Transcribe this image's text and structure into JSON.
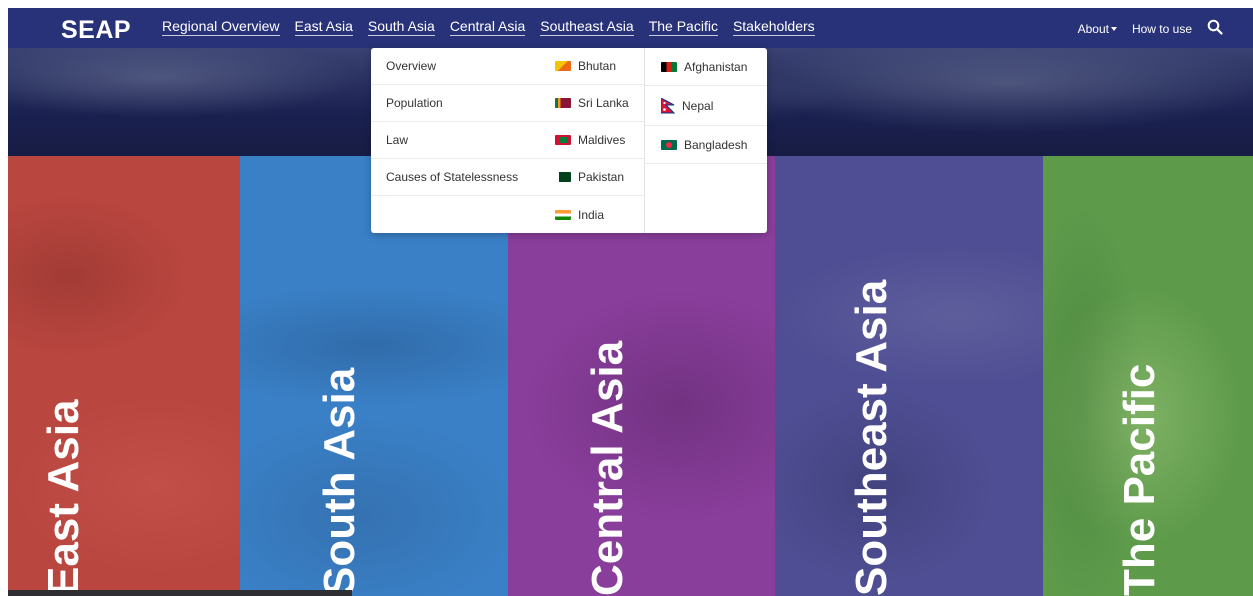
{
  "nav": {
    "logo": "SEAP",
    "links": [
      "Regional Overview",
      "East Asia",
      "South Asia",
      "Central Asia",
      "Southeast Asia",
      "The Pacific",
      "Stakeholders"
    ],
    "about": "About",
    "how_to_use": "How to use"
  },
  "dropdown": {
    "topics": [
      "Overview",
      "Population",
      "Law",
      "Causes of Statelessness"
    ],
    "countries_col1": [
      {
        "name": "Bhutan",
        "flag": "bhutan-flag"
      },
      {
        "name": "Sri Lanka",
        "flag": "sri-lanka-flag"
      },
      {
        "name": "Maldives",
        "flag": "maldives-flag"
      },
      {
        "name": "Pakistan",
        "flag": "pakistan-flag"
      },
      {
        "name": "India",
        "flag": "india-flag"
      }
    ],
    "countries_col2": [
      {
        "name": "Afghanistan",
        "flag": "afghanistan-flag"
      },
      {
        "name": "Nepal",
        "flag": "nepal-flag"
      },
      {
        "name": "Bangladesh",
        "flag": "bangladesh-flag"
      }
    ]
  },
  "panels": [
    {
      "label": "East Asia",
      "color": "#b9463f"
    },
    {
      "label": "South Asia",
      "color": "#3a80c6"
    },
    {
      "label": "Central Asia",
      "color": "#8a3e9c"
    },
    {
      "label": "Southeast Asia",
      "color": "#4f4e94"
    },
    {
      "label": "The Pacific",
      "color": "#5d9a4a"
    }
  ],
  "colors": {
    "nav_bg": "#283278",
    "hero_bg": "#1b2150"
  }
}
